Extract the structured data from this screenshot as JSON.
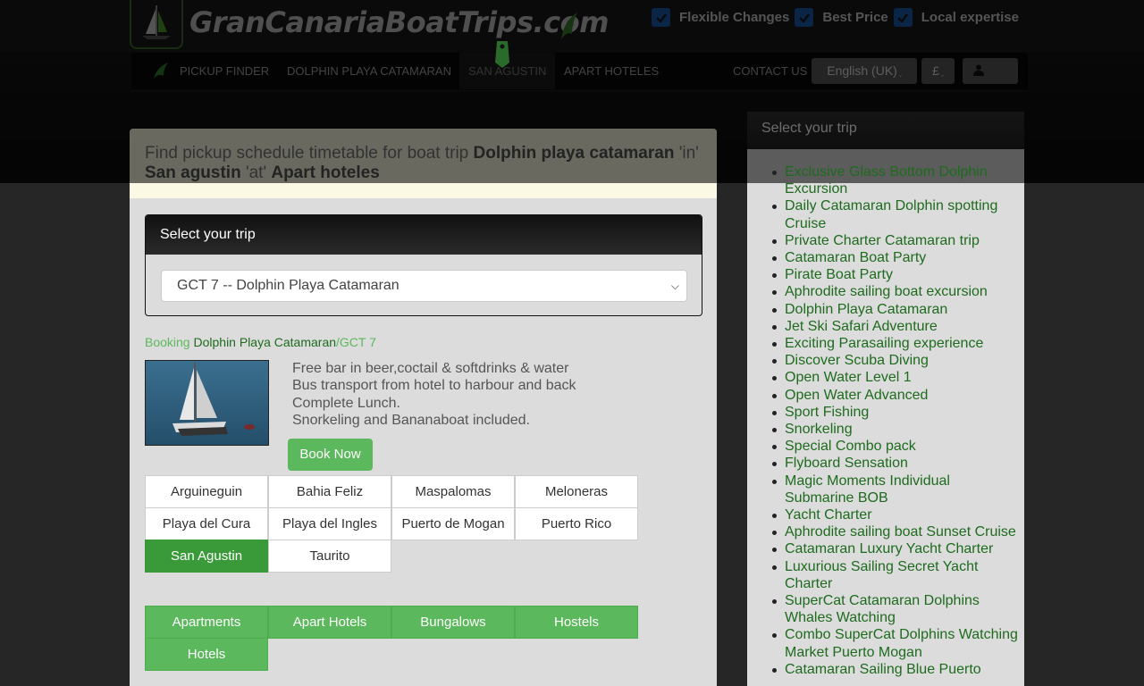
{
  "header": {
    "logo_text": "GranCanariaBoatTrips.com",
    "features": [
      {
        "label": "Flexible Changes"
      },
      {
        "label": "Best Price"
      },
      {
        "label": "Local expertise"
      }
    ]
  },
  "nav": {
    "items": [
      "PICKUP FINDER",
      "DOLPHIN PLAYA CATAMARAN",
      "SAN AGUSTIN",
      "APART HOTELES"
    ],
    "contact": "CONTACT US",
    "language": "English (UK)",
    "currency": "£",
    "user_icon": "user-icon"
  },
  "pickup": {
    "prefix": "Find pickup schedule timetable for boat trip ",
    "trip": "Dolphin playa catamaran",
    "in": " 'in' ",
    "location": "San agustin",
    "at": " 'at' ",
    "category": "Apart hoteles"
  },
  "trip_select": {
    "heading": "Select your trip",
    "selected": "GCT 7 -- Dolphin Playa Catamaran"
  },
  "booking": {
    "label": "Booking",
    "trip": "Dolphin Playa Catamaran",
    "code": "/GCT 7",
    "features": [
      "Free bar in beer,coctail & softdrinks & water",
      "Bus transport from hotel to harbour and back",
      "Complete Lunch.",
      "Snorkeling and Bananaboat included."
    ],
    "book_button": "Book Now"
  },
  "locations": {
    "items": [
      "Arguineguin",
      "Bahia Feliz",
      "Maspalomas",
      "Meloneras",
      "Playa del Cura",
      "Playa del Ingles",
      "Puerto de Mogan",
      "Puerto Rico",
      "San Agustin",
      "Taurito"
    ],
    "active": "San Agustin"
  },
  "accommodation_types": [
    "Apartments",
    "Apart Hotels",
    "Bungalows",
    "Hostels",
    "Hotels"
  ],
  "sidebar": {
    "heading": "Select your trip",
    "trips": [
      "Exclusive Glass Bottom Dolphin Excursion",
      "Daily Catamaran Dolphin spotting Cruise",
      "Private Charter Catamaran trip",
      "Catamaran Boat Party",
      "Pirate Boat Party",
      "Aphrodite sailing boat excursion",
      "Dolphin Playa Catamaran",
      "Jet Ski Safari Adventure",
      "Exciting Parasailing experience",
      "Discover Scuba Diving",
      "Open Water Level 1",
      "Open Water Advanced",
      "Sport Fishing",
      "Snorkeling",
      "Special Combo pack",
      "Flyboard Sensation",
      "Magic Moments Individual Submarine BOB",
      "Yacht Charter",
      "Aphrodite sailing boat Sunset Cruise",
      "Catamaran Luxury Yacht Charter",
      "Luxurious Sailing Secret Yacht Charter",
      "SuperCat Catamaran Dolphins Whales Watching",
      "Combo SuperCat Dolphins Watching Market Puerto Mogan",
      "Catamaran Sailing Blue Puerto"
    ]
  }
}
